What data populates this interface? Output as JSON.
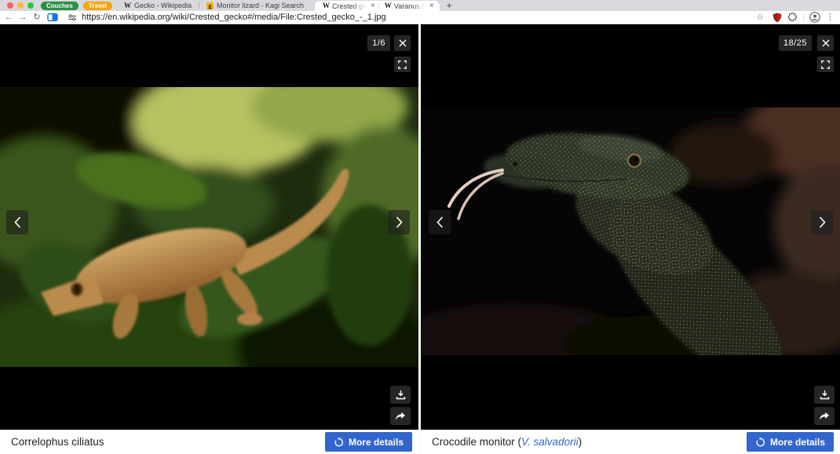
{
  "tab_strip": {
    "groups": [
      {
        "label": "Couches",
        "color": "#2d9044"
      },
      {
        "label": "Travel",
        "color": "#f4a60a"
      }
    ],
    "tabs": [
      {
        "label": "Gecko - Wikipedia"
      },
      {
        "label": "Monitor lizard - Kagi Search"
      },
      {
        "label": "Crested ge"
      },
      {
        "label": "Varanus Sa"
      }
    ],
    "new_tab_glyph": "+",
    "close_glyph": "×",
    "wikipedia_glyph": "W",
    "kagi_glyph": "g"
  },
  "toolbar": {
    "back_glyph": "←",
    "forward_glyph": "→",
    "reload_glyph": "↻",
    "star_glyph": "☆",
    "menu_glyph": "⋮",
    "url": "https://en.wikipedia.org/wiki/Crested_gecko#/media/File:Crested_gecko_-_1.jpg"
  },
  "left_viewer": {
    "counter": "1/6",
    "caption": "Correlophus ciliatus",
    "more_details_label": "More details"
  },
  "right_viewer": {
    "counter": "18/25",
    "caption_prefix": "Crocodile monitor (",
    "caption_link": "V. salvadorii",
    "caption_suffix": ")",
    "more_details_label": "More details"
  },
  "colors": {
    "group_green": "#2d9044",
    "group_orange": "#f4a60a",
    "wikimedia_blue": "#3366cc",
    "chrome_blue": "#1a73e8",
    "ublock_red": "#9b1b1b"
  }
}
